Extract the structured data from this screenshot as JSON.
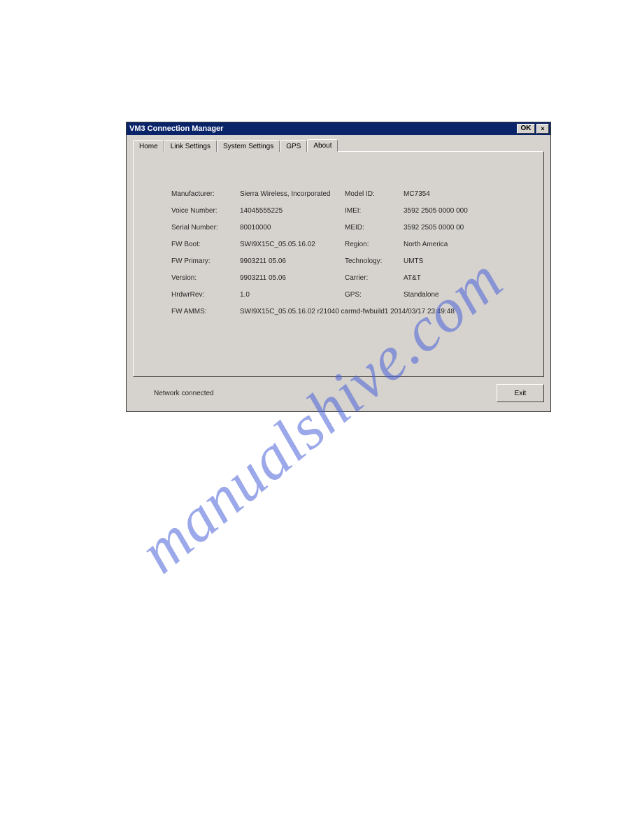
{
  "watermark": "manualshive.com",
  "window": {
    "title": "VM3 Connection Manager",
    "ok_label": "OK",
    "close_label": "×"
  },
  "tabs": {
    "home": "Home",
    "link": "Link Settings",
    "system": "System Settings",
    "gps": "GPS",
    "about": "About"
  },
  "about": {
    "manufacturer_label": "Manufacturer:",
    "manufacturer_value": "Sierra Wireless, Incorporated",
    "model_id_label": "Model ID:",
    "model_id_value": "MC7354",
    "voice_number_label": "Voice Number:",
    "voice_number_value": "14045555225",
    "imei_label": "IMEI:",
    "imei_value": "3592 2505 0000 000",
    "serial_number_label": "Serial Number:",
    "serial_number_value": "80010000",
    "meid_label": "MEID:",
    "meid_value": "3592 2505 0000 00",
    "fw_boot_label": "FW Boot:",
    "fw_boot_value": "SWI9X15C_05.05.16.02",
    "region_label": "Region:",
    "region_value": "North America",
    "fw_primary_label": "FW Primary:",
    "fw_primary_value": "9903211 05.06",
    "technology_label": "Technology:",
    "technology_value": "UMTS",
    "version_label": "Version:",
    "version_value": "9903211 05.06",
    "carrier_label": "Carrier:",
    "carrier_value": "AT&T",
    "hw_rev_label": "HrdwrRev:",
    "hw_rev_value": "1.0",
    "gps_label": "GPS:",
    "gps_value": "Standalone",
    "fw_amms_label": "FW AMMS:",
    "fw_amms_value": "SWI9X15C_05.05.16.02 r21040 carmd-fwbuild1 2014/03/17 23:49:48"
  },
  "status": {
    "text": "Network connected",
    "exit_label": "Exit"
  }
}
